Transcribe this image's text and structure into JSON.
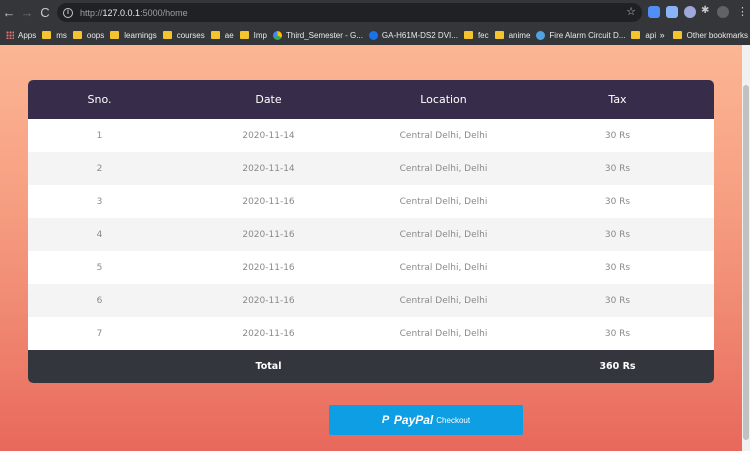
{
  "browser": {
    "url_host": "127.0.0.1",
    "url_rest": ":5000/home",
    "url_scheme": "http://",
    "bookmarks": [
      {
        "label": "Apps",
        "type": "apps"
      },
      {
        "label": "ms",
        "type": "folder"
      },
      {
        "label": "oops",
        "type": "folder"
      },
      {
        "label": "learnings",
        "type": "folder"
      },
      {
        "label": "courses",
        "type": "folder"
      },
      {
        "label": "ae",
        "type": "folder"
      },
      {
        "label": "Imp",
        "type": "folder"
      },
      {
        "label": "Third_Semester - G...",
        "type": "drive"
      },
      {
        "label": "GA-H61M-DS2 DVI...",
        "type": "site"
      },
      {
        "label": "fec",
        "type": "folder"
      },
      {
        "label": "anime",
        "type": "folder"
      },
      {
        "label": "Fire Alarm Circuit D...",
        "type": "globe"
      },
      {
        "label": "api",
        "type": "folder"
      }
    ],
    "overflow": "»",
    "other_bookmarks": "Other bookmarks"
  },
  "table": {
    "headers": [
      "Sno.",
      "Date",
      "Location",
      "Tax"
    ],
    "rows": [
      [
        "1",
        "2020-11-14",
        "Central Delhi, Delhi",
        "30 Rs"
      ],
      [
        "2",
        "2020-11-14",
        "Central Delhi, Delhi",
        "30 Rs"
      ],
      [
        "3",
        "2020-11-16",
        "Central Delhi, Delhi",
        "30 Rs"
      ],
      [
        "4",
        "2020-11-16",
        "Central Delhi, Delhi",
        "30 Rs"
      ],
      [
        "5",
        "2020-11-16",
        "Central Delhi, Delhi",
        "30 Rs"
      ],
      [
        "6",
        "2020-11-16",
        "Central Delhi, Delhi",
        "30 Rs"
      ],
      [
        "7",
        "2020-11-16",
        "Central Delhi, Delhi",
        "30 Rs"
      ]
    ],
    "total_label": "Total",
    "total_value": "360 Rs"
  },
  "paypal": {
    "brand": "PayPal",
    "action": "Checkout",
    "color": "#0d9ee3"
  },
  "colors": {
    "header_bg": "#372c4a",
    "footer_bg": "#33363d",
    "gradient_top": "#fbb693",
    "gradient_bottom": "#e8685c"
  }
}
